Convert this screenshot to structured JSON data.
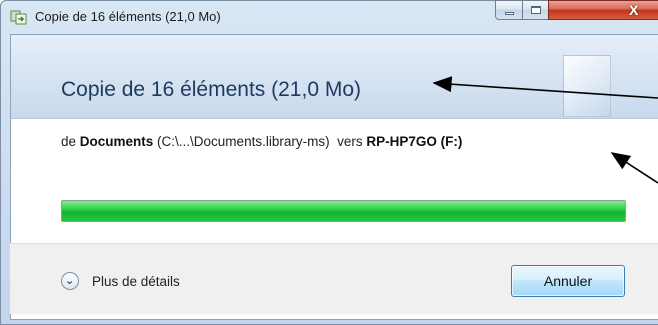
{
  "window": {
    "title": "Copie de 16 éléments (21,0 Mo)"
  },
  "titlebar": {
    "icons": {
      "app": "copy-files-icon",
      "minimize": "minimize-icon",
      "maximize": "maximize-icon",
      "close": "close-icon"
    },
    "close_glyph": "X"
  },
  "dialog": {
    "header": "Copie de 16 éléments (21,0 Mo)",
    "route": {
      "from_prefix": "de ",
      "source_name": "Documents",
      "source_path": " (C:\\...\\Documents.library-ms)",
      "to_prefix": "  vers ",
      "destination_name": "RP-HP7GO (F:)"
    },
    "progress": {
      "fraction": 1.0
    },
    "details": {
      "label": "Plus de détails",
      "icon": "chevron-down-icon"
    },
    "cancel_label": "Annuler"
  },
  "colors": {
    "progress_green": "#16b832",
    "header_text": "#1e3a5f",
    "close_red": "#c3331e"
  }
}
